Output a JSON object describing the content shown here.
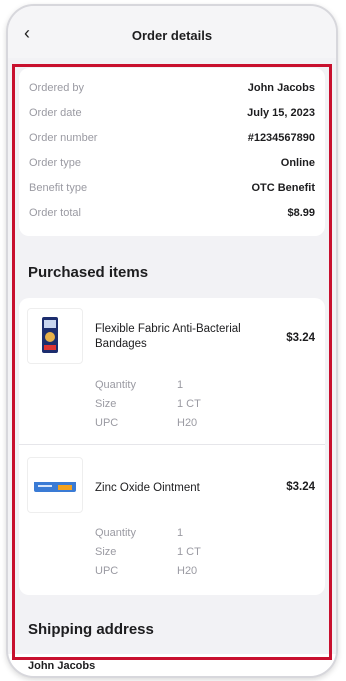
{
  "header": {
    "title": "Order details",
    "back_icon": "‹"
  },
  "summary": [
    {
      "label": "Ordered by",
      "value": "John Jacobs"
    },
    {
      "label": "Order date",
      "value": "July 15, 2023"
    },
    {
      "label": "Order number",
      "value": "#1234567890"
    },
    {
      "label": "Order type",
      "value": "Online"
    },
    {
      "label": "Benefit type",
      "value": "OTC Benefit"
    },
    {
      "label": "Order total",
      "value": "$8.99"
    }
  ],
  "purchased": {
    "title": "Purchased items",
    "items": [
      {
        "name": "Flexible Fabric Anti-Bacterial Bandages",
        "price": "$3.24",
        "attrs": [
          {
            "label": "Quantity",
            "value": "1"
          },
          {
            "label": "Size",
            "value": "1 CT"
          },
          {
            "label": "UPC",
            "value": "H20"
          }
        ]
      },
      {
        "name": "Zinc Oxide Ointment",
        "price": "$3.24",
        "attrs": [
          {
            "label": "Quantity",
            "value": "1"
          },
          {
            "label": "Size",
            "value": "1 CT"
          },
          {
            "label": "UPC",
            "value": "H20"
          }
        ]
      }
    ]
  },
  "shipping": {
    "title": "Shipping address",
    "name": "John Jacobs"
  },
  "colors": {
    "highlight": "#c8102e",
    "background": "#f2f2f5",
    "text": "#1d1d1f",
    "muted": "#9a9aa2"
  }
}
